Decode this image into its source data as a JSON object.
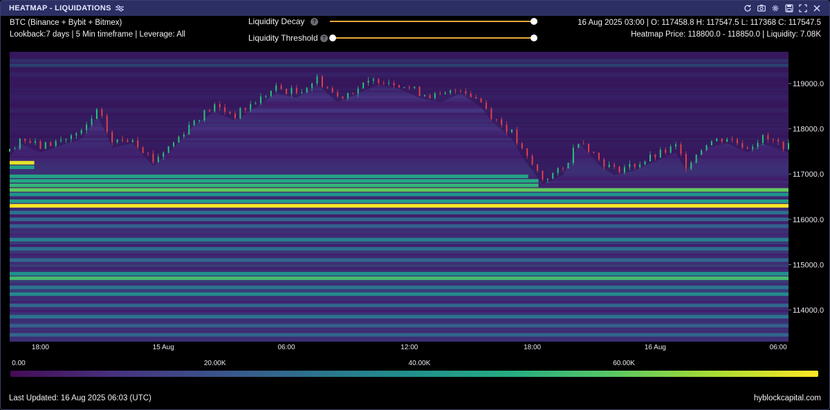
{
  "window": {
    "title": "HEATMAP - LIQUIDATIONS",
    "icons": [
      "settings-sliders-icon",
      "refresh-icon",
      "camera-icon",
      "gear-icon",
      "save-icon",
      "expand-icon",
      "close-icon"
    ]
  },
  "info": {
    "source": "BTC (Binance + Bybit + Bitmex)",
    "settings": "Lookback:7 days | 5 Min timeframe | Leverage: All",
    "ohlc": "16 Aug 2025 03:00 | O: 117458.8 H: 117547.5 L: 117368 C: 117547.5",
    "heatmap_price": "Heatmap Price: 118800.0 - 118850.0 | Liquidity: 7.08K"
  },
  "controls": {
    "decay_label": "Liquidity Decay",
    "threshold_label": "Liquidity Threshold",
    "decay_value": 1.0,
    "threshold_min": 0.0,
    "threshold_max": 1.0
  },
  "legend": {
    "ticks": [
      "0.00",
      "20.00K",
      "40.00K",
      "60.00K"
    ],
    "tick_values": [
      0,
      20000,
      40000,
      60000
    ],
    "max_value": 79000,
    "colors": [
      "#450c55",
      "#46307e",
      "#3b528b",
      "#2c728e",
      "#21908d",
      "#27ad81",
      "#5cc863",
      "#aadc32",
      "#fde725"
    ]
  },
  "footer": {
    "updated": "Last Updated: 16 Aug 2025 06:03 (UTC)",
    "brand": "hyblockcapital.com"
  },
  "chart_data": {
    "type": "heatmap",
    "x_ticks": [
      "18:00",
      "15 Aug",
      "06:00",
      "12:00",
      "18:00",
      "16 Aug",
      "06:00"
    ],
    "x_tick_hours": [
      0,
      6,
      12,
      18,
      24,
      30,
      36
    ],
    "x_range_hours": [
      -1.5,
      36.5
    ],
    "y_ticks": [
      "119000.0",
      "118000.0",
      "117000.0",
      "116000.0",
      "115000.0",
      "114000.0"
    ],
    "y_tick_values": [
      119000,
      118000,
      117000,
      116000,
      115000,
      114000
    ],
    "ylim": [
      113300,
      119700
    ],
    "price_path": [
      [
        -1.5,
        117500
      ],
      [
        -1,
        117800
      ],
      [
        0,
        117600
      ],
      [
        1,
        117750
      ],
      [
        2,
        117900
      ],
      [
        2.8,
        118400
      ],
      [
        3.5,
        117700
      ],
      [
        4.5,
        117800
      ],
      [
        5.5,
        117300
      ],
      [
        6.5,
        117700
      ],
      [
        7.5,
        118200
      ],
      [
        8.5,
        118500
      ],
      [
        9.5,
        118300
      ],
      [
        10.5,
        118600
      ],
      [
        11.5,
        118900
      ],
      [
        12.5,
        118800
      ],
      [
        13.5,
        119100
      ],
      [
        14.5,
        118700
      ],
      [
        15.5,
        118900
      ],
      [
        16.5,
        119100
      ],
      [
        17.5,
        119000
      ],
      [
        18.5,
        118800
      ],
      [
        19.5,
        118700
      ],
      [
        20.5,
        118900
      ],
      [
        21.5,
        118600
      ],
      [
        22,
        118300
      ],
      [
        23,
        117900
      ],
      [
        23.5,
        117500
      ],
      [
        24,
        117200
      ],
      [
        24.5,
        116900
      ],
      [
        25.5,
        117100
      ],
      [
        26.3,
        117800
      ],
      [
        27.3,
        117300
      ],
      [
        28,
        117100
      ],
      [
        29,
        117200
      ],
      [
        30,
        117400
      ],
      [
        31,
        117600
      ],
      [
        31.5,
        117200
      ],
      [
        32.5,
        117700
      ],
      [
        33.5,
        117800
      ],
      [
        34.5,
        117600
      ],
      [
        35.2,
        117800
      ],
      [
        36.5,
        117600
      ]
    ],
    "bands": [
      {
        "price": 119500,
        "value": 20000
      },
      {
        "price": 119400,
        "value": 32000
      },
      {
        "price": 119200,
        "value": 12000
      },
      {
        "price": 118700,
        "value": 10000
      },
      {
        "price": 118400,
        "value": 11000
      },
      {
        "price": 118000,
        "value": 10000
      },
      {
        "price": 117250,
        "value": 76000,
        "end_hour": -0.3
      },
      {
        "price": 117150,
        "value": 45000,
        "end_hour": -0.3
      },
      {
        "price": 116950,
        "value": 46000,
        "end_hour": 23.8
      },
      {
        "price": 116850,
        "value": 48000,
        "end_hour": 24.3
      },
      {
        "price": 116750,
        "value": 52000,
        "end_hour": 24.3
      },
      {
        "price": 116650,
        "value": 60000
      },
      {
        "price": 116550,
        "value": 40000
      },
      {
        "price": 116400,
        "value": 44000
      },
      {
        "price": 116300,
        "value": 79000
      },
      {
        "price": 116150,
        "value": 30000
      },
      {
        "price": 116000,
        "value": 26000
      },
      {
        "price": 115850,
        "value": 24000
      },
      {
        "price": 115550,
        "value": 34000
      },
      {
        "price": 115350,
        "value": 28000
      },
      {
        "price": 115100,
        "value": 26000
      },
      {
        "price": 114800,
        "value": 40000
      },
      {
        "price": 114700,
        "value": 55000
      },
      {
        "price": 114500,
        "value": 30000
      },
      {
        "price": 114350,
        "value": 38000
      },
      {
        "price": 114100,
        "value": 26000
      },
      {
        "price": 113850,
        "value": 30000
      },
      {
        "price": 113650,
        "value": 24000
      },
      {
        "price": 113450,
        "value": 26000
      }
    ]
  }
}
